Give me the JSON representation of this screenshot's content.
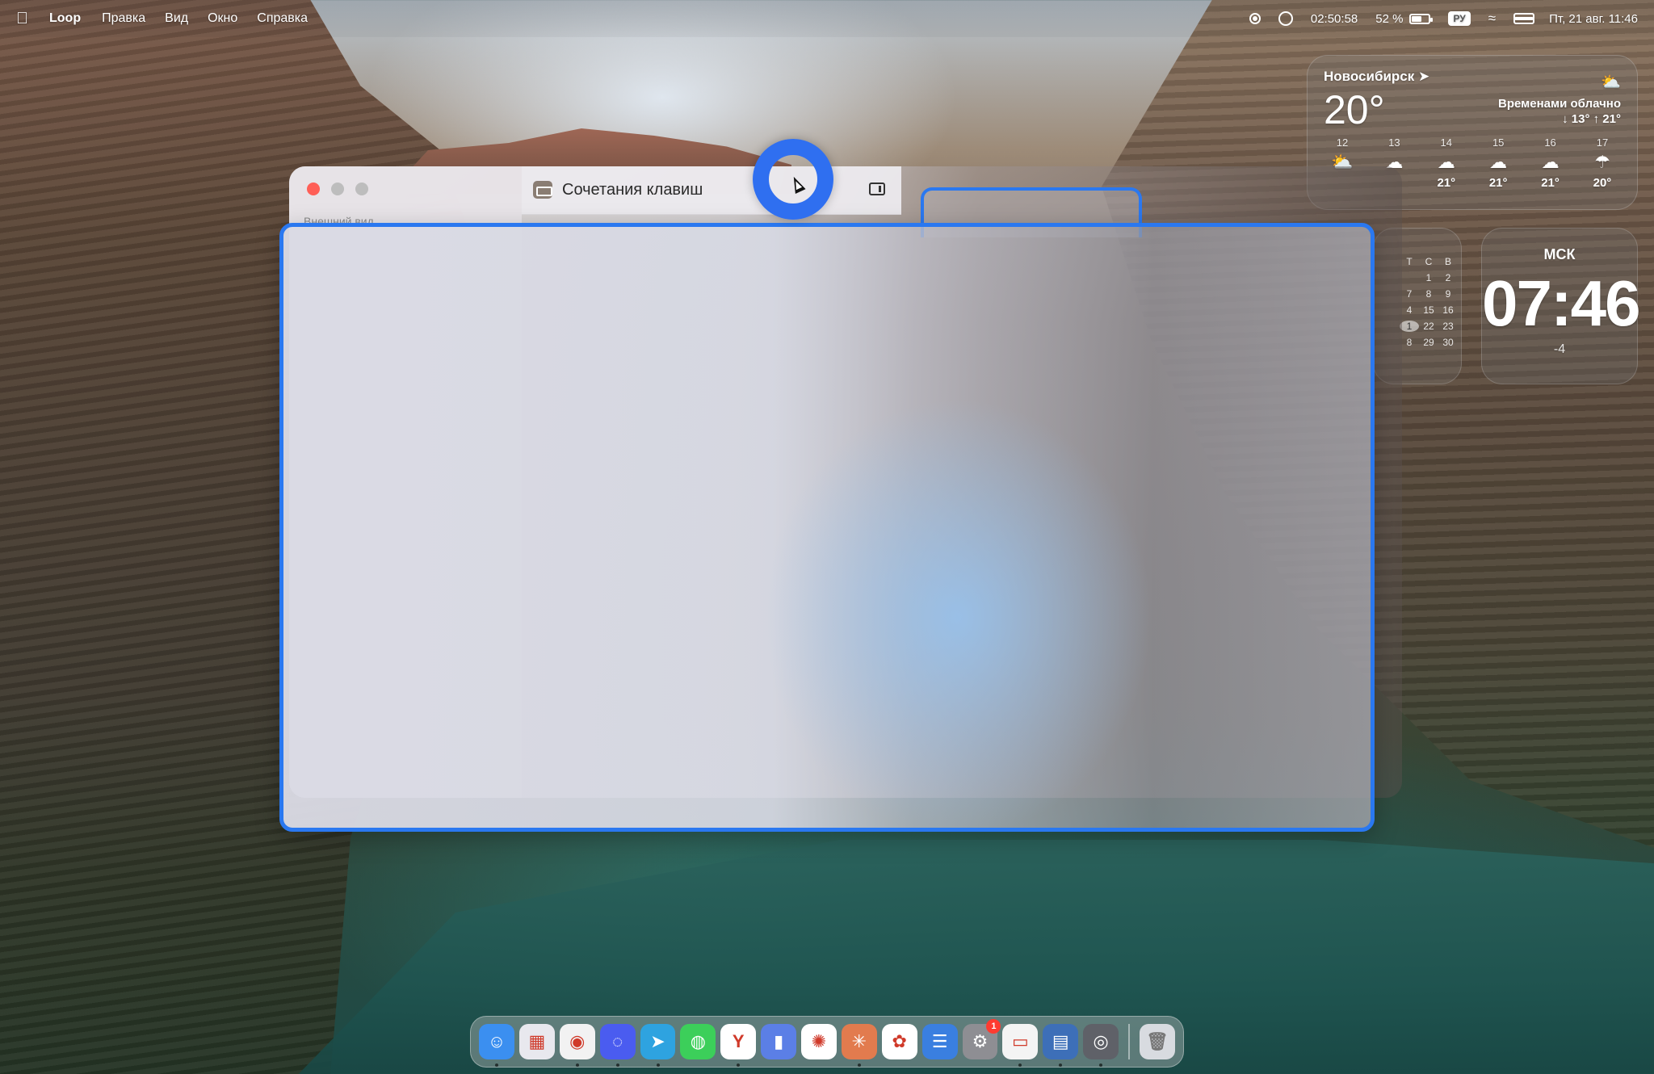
{
  "menubar": {
    "app_name": "Loop",
    "menus": [
      "Правка",
      "Вид",
      "Окно",
      "Справка"
    ],
    "status": {
      "timer": "02:50:58",
      "battery": "52 %",
      "input_source": "РУ",
      "datetime": "Пт, 21 авг. 11:46"
    }
  },
  "weather": {
    "city": "Новосибирск",
    "temperature": "20°",
    "condition": "Временами облачно",
    "range": "↓ 13° ↑ 21°",
    "hours": [
      {
        "hour": "12",
        "icon": "sun-cloud-icon",
        "temp": ""
      },
      {
        "hour": "13",
        "icon": "cloud-icon",
        "temp": ""
      },
      {
        "hour": "14",
        "icon": "cloud-icon",
        "temp": "21°"
      },
      {
        "hour": "15",
        "icon": "cloud-icon",
        "temp": "21°"
      },
      {
        "hour": "16",
        "icon": "cloud-icon",
        "temp": "21°"
      },
      {
        "hour": "17",
        "icon": "rain-cloud-icon",
        "temp": "20°"
      }
    ]
  },
  "calendar": {
    "header": [
      "Т",
      "С",
      "В"
    ],
    "rows": [
      [
        "",
        "1",
        "2"
      ],
      [
        "7",
        "8",
        "9"
      ],
      [
        "4",
        "15",
        "16"
      ],
      [
        "1",
        "22",
        "23"
      ],
      [
        "8",
        "29",
        "30"
      ]
    ]
  },
  "clock": {
    "zone": "МСК",
    "time": "07:46",
    "offset": "-4"
  },
  "window": {
    "title": "Сочетания клавиш",
    "sidebar_label": "Внешний вид"
  },
  "dock": {
    "items": [
      {
        "name": "finder",
        "color": "#3b8ff0",
        "glyph": "☺",
        "running": true
      },
      {
        "name": "launchpad",
        "color": "#e8e8ee",
        "glyph": "▦",
        "running": false
      },
      {
        "name": "chrome",
        "color": "#f2f2f2",
        "glyph": "◉",
        "running": true
      },
      {
        "name": "messenger",
        "color": "#4a5cf0",
        "glyph": "◌",
        "running": true
      },
      {
        "name": "telegram",
        "color": "#2ea3e0",
        "glyph": "➤",
        "running": true
      },
      {
        "name": "messages",
        "color": "#3ccf5a",
        "glyph": "◍",
        "running": false
      },
      {
        "name": "yandex",
        "color": "#ffffff",
        "glyph": "Y",
        "running": true
      },
      {
        "name": "notes-app",
        "color": "#5b7fe6",
        "glyph": "▮",
        "running": false
      },
      {
        "name": "chatgpt",
        "color": "#ffffff",
        "glyph": "✺",
        "running": false
      },
      {
        "name": "claude",
        "color": "#e27b4e",
        "glyph": "✳",
        "running": true
      },
      {
        "name": "photos",
        "color": "#ffffff",
        "glyph": "✿",
        "running": false
      },
      {
        "name": "network-app",
        "color": "#3a7fe0",
        "glyph": "☰",
        "running": false
      },
      {
        "name": "system-settings",
        "color": "#8e8e93",
        "glyph": "⚙",
        "running": false,
        "badge": "1"
      },
      {
        "name": "notepad",
        "color": "#f4f4f4",
        "glyph": "▭",
        "running": true
      },
      {
        "name": "disk-app",
        "color": "#3d6fb8",
        "glyph": "▤",
        "running": true
      },
      {
        "name": "loop",
        "color": "#5f6168",
        "glyph": "◎",
        "running": true
      }
    ],
    "trash": {
      "name": "trash",
      "color": "#d8dbe0",
      "glyph": "🗑"
    }
  },
  "colors": {
    "accent": "#2a78f0",
    "close": "#ff5f57"
  }
}
